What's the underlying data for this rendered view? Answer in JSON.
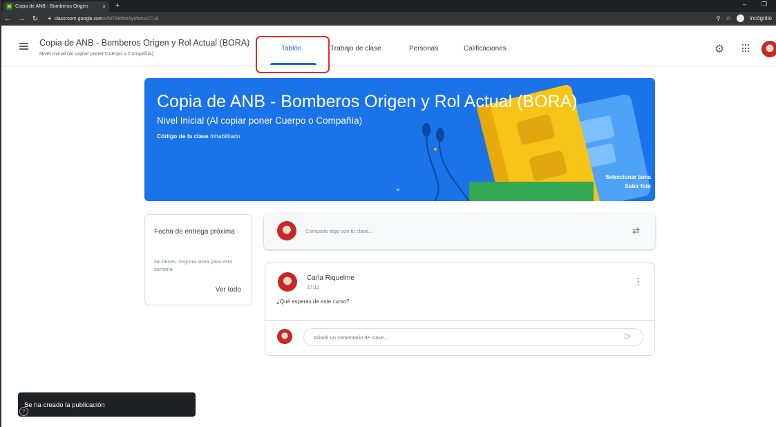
{
  "browser": {
    "tab_title": "Copia de ANB - Bomberos Origen",
    "tab_close": "×",
    "new_tab": "+",
    "url_host": "classroom.google.com",
    "url_path": "/c/MTM0MzAyMzAxOTU0",
    "profile": "Incógnito",
    "icons": [
      "back-icon",
      "forward-icon",
      "reload-icon",
      "lock-icon",
      "zoom-icon",
      "star-icon",
      "incognito-icon"
    ]
  },
  "header": {
    "class_title": "Copia de ANB - Bomberos Origen y Rol Actual (BORA)",
    "class_subtitle": "Nivel Inicial (Al copiar poner Cuerpo o Compañía)",
    "tabs": [
      {
        "label": "Tablón",
        "active": true
      },
      {
        "label": "Trabajo de clase",
        "active": false
      },
      {
        "label": "Personas",
        "active": false
      },
      {
        "label": "Calificaciones",
        "active": false
      }
    ]
  },
  "banner": {
    "title": "Copia de ANB - Bomberos Origen y Rol Actual (BORA)",
    "subtitle": "Nivel Inicial (Al copiar poner Cuerpo o Compañía)",
    "code_label": "Código de la clase",
    "code_value": "Inhabilitado",
    "select_theme": "Seleccionar tema",
    "upload_photo": "Subir foto",
    "color": "#1a73e8"
  },
  "upcoming": {
    "title": "Fecha de entrega próxima",
    "empty_text": "No tienes ninguna tarea para esta semana",
    "view_all": "Ver todo"
  },
  "share": {
    "placeholder": "Comparte algo con tu clase..."
  },
  "post": {
    "author": "Carla Riquelme",
    "time": "17:11",
    "body": "¿Qué esperas de este curso?",
    "comment_placeholder": "Añadir un comentario de clase..."
  },
  "snackbar": {
    "message": "Se ha creado la publicación"
  },
  "colors": {
    "accent": "#1967d2",
    "highlight": "#d93025"
  }
}
